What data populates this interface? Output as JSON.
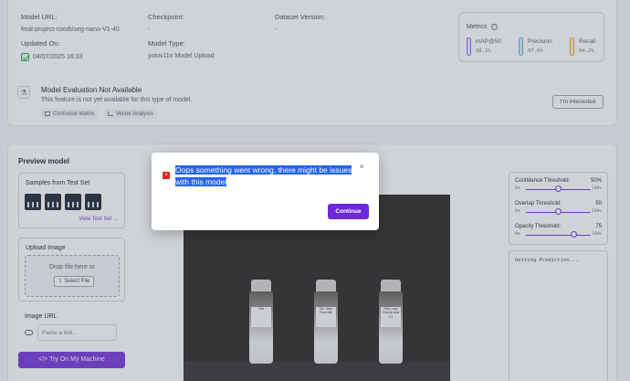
{
  "info": {
    "model_url_label": "Model URL:",
    "model_url": "final-project-roxvb/seg-nano-V1-40",
    "checkpoint_label": "Checkpoint:",
    "checkpoint": "-",
    "dataset_version_label": "Dataset Version:",
    "dataset_version": "-",
    "updated_on_label": "Updated On:",
    "updated_on": "04/07/2025 16:33",
    "model_type_label": "Model Type:",
    "model_type": "yolov11n Model Upload"
  },
  "metrics": {
    "title": "Metrics",
    "items": [
      {
        "name": "mAP@50",
        "value": "98.2%",
        "color": "#8b5cf6"
      },
      {
        "name": "Precision",
        "value": "97.0%",
        "color": "#60a5fa"
      },
      {
        "name": "Recall",
        "value": "94.2%",
        "color": "#f59e0b"
      }
    ]
  },
  "evaluation": {
    "title": "Model Evaluation Not Available",
    "description": "This feature is not yet available for this type of model.",
    "chip_confusion": "Confusion Matrix",
    "chip_vector": "Vector Analysis",
    "interest_button": "I'm interested"
  },
  "preview": {
    "title": "Preview model",
    "samples_title": "Samples from Test Set",
    "view_test_set": "View Test Set →",
    "upload_title": "Upload Image",
    "drop_text": "Drop file here or",
    "select_file": "Select File",
    "image_url_title": "Image URL",
    "url_placeholder": "Paste a link...",
    "try_button": "Try On My Machine",
    "vial_labels": [
      "Vial",
      "Sol. blue Fluoride",
      "Rher-aryl Clorde and Cl"
    ]
  },
  "controls": {
    "confidence": {
      "label": "Confidence Threshold:",
      "value": "50%",
      "min": "0%",
      "max": "100%",
      "level": 0.5
    },
    "overlap": {
      "label": "Overlap Threshold:",
      "value": "50",
      "min": "0%",
      "max": "100%",
      "level": 0.5
    },
    "opacity": {
      "label": "Opacity Threshold:",
      "value": "75",
      "min": "0%",
      "max": "100%",
      "level": 0.75
    },
    "prediction_text": "Getting Prediction..."
  },
  "modal": {
    "message": "Oops something went wrong, there might be issues with this model",
    "close": "×",
    "continue": "Continue"
  }
}
